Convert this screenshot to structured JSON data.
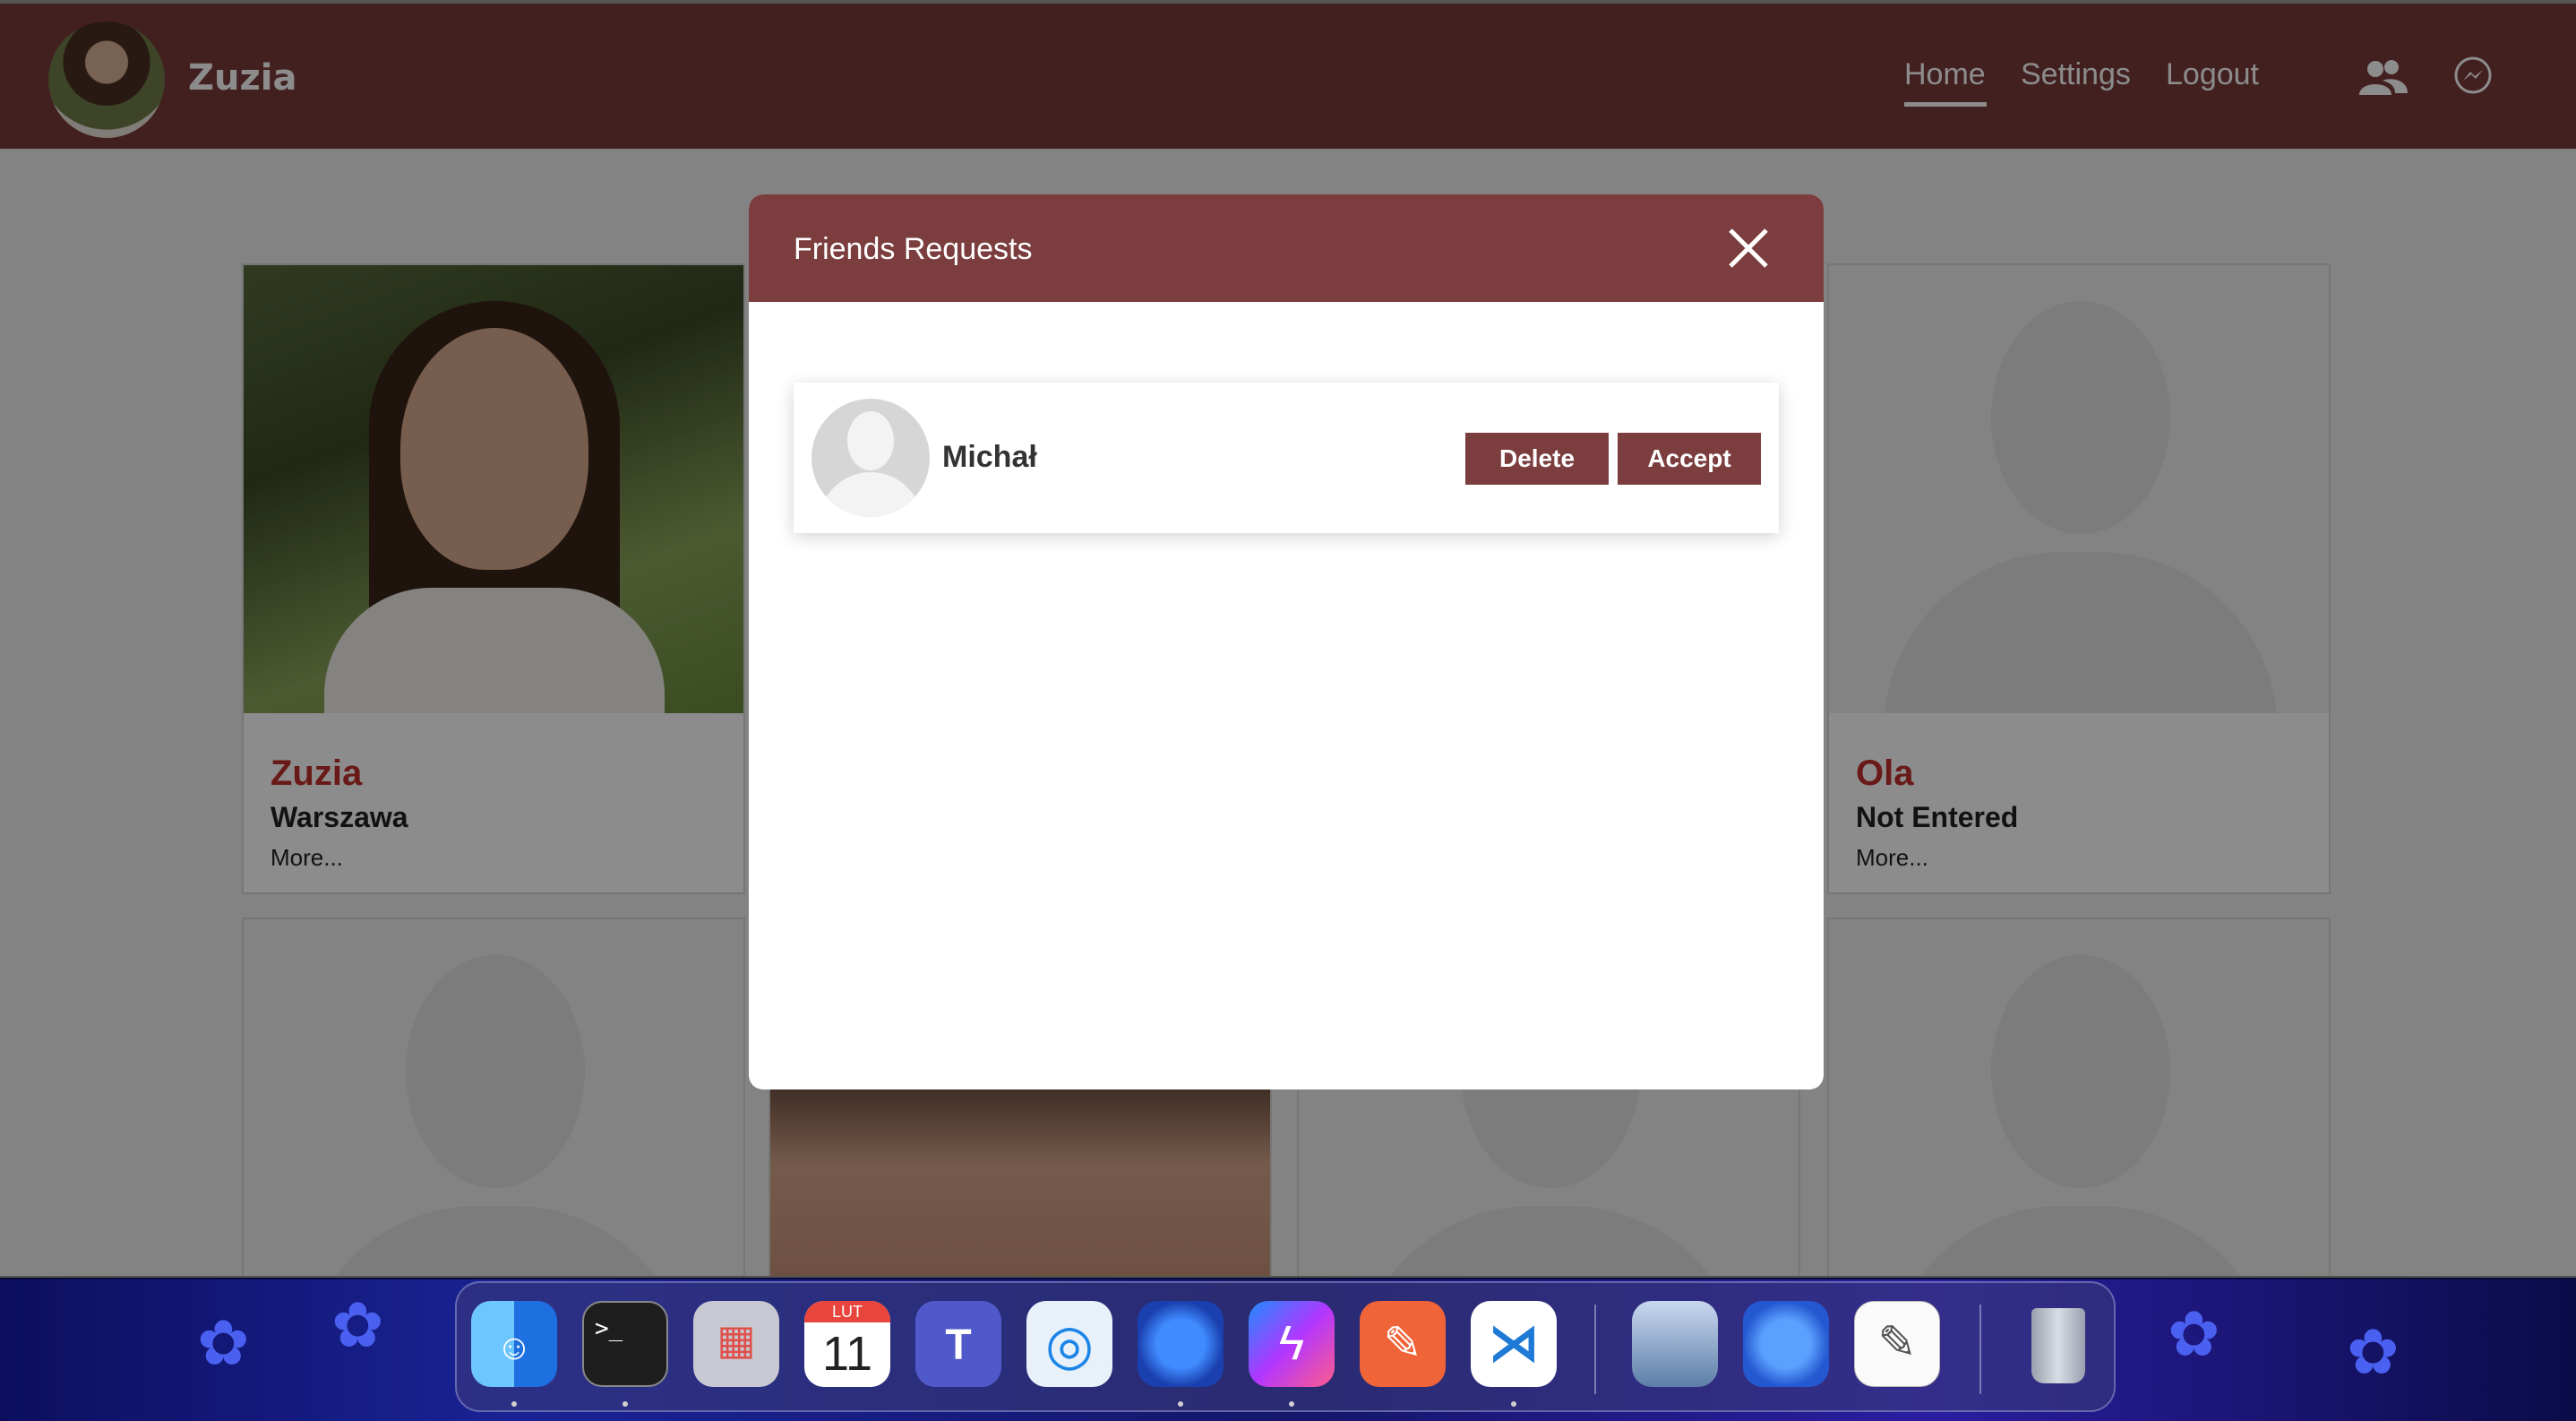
{
  "app": {
    "username": "Zuzia",
    "nav": {
      "home": "Home",
      "settings": "Settings",
      "logout": "Logout"
    }
  },
  "cards": [
    {
      "name": "Zuzia",
      "city": "Warszawa",
      "more": "More..."
    },
    {
      "name": "Ola",
      "city": "Not Entered",
      "more": "More..."
    }
  ],
  "modal": {
    "title": "Friends Requests",
    "request": {
      "name": "Michał",
      "delete_label": "Delete",
      "accept_label": "Accept"
    }
  },
  "dock": {
    "calendar_month": "LUT",
    "calendar_day": "11",
    "apps": [
      "finder-icon",
      "terminal-icon",
      "launchpad-icon",
      "calendar-icon",
      "teams-icon",
      "safari-icon",
      "firefox-icon",
      "messenger-icon",
      "postman-icon",
      "vscode-icon",
      "preview-icon",
      "firefox-dev-icon",
      "textedit-icon",
      "trash-icon"
    ]
  },
  "colors": {
    "navbar": "#7a3b3b",
    "modal_header": "#7b3d3d",
    "button": "#7b3d3d",
    "card_name": "#c0302c"
  }
}
